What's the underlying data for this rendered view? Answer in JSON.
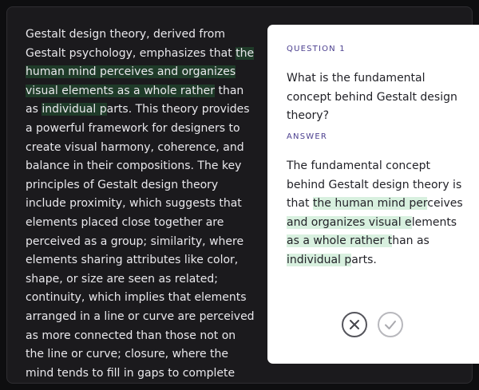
{
  "passage": {
    "segments": [
      {
        "text": "Gestalt design theory, derived from Gestalt psychology, emphasizes that ",
        "hl": false
      },
      {
        "text": "the human mind perceives and organizes visual elements as a whole rather",
        "hl": true
      },
      {
        "text": " than as ",
        "hl": false
      },
      {
        "text": "individual p",
        "hl": true
      },
      {
        "text": "arts. This theory provides a powerful framework for designers to create visual harmony, coherence, and balance in their compositions. The key principles of Gestalt design theory include proximity, which suggests that elements placed close together are perceived as a group; similarity, where elements sharing attributes like color, shape, or size are seen as related; continuity, which implies that elements arranged in a line or curve are perceived as more connected than those not on the line or curve; closure, where the mind tends to fill in gaps to complete shapes or patterns even when",
        "hl": false
      }
    ]
  },
  "card": {
    "question_label": "QUESTION 1",
    "question_text": "What is the fundamental concept behind Gestalt design theory?",
    "answer_label": "ANSWER",
    "answer_segments": [
      {
        "text": "The fundamental concept behind Gestalt design theory is that ",
        "hl": false
      },
      {
        "text": "the human mind per",
        "hl": true
      },
      {
        "text": "ceives ",
        "hl": false
      },
      {
        "text": "and organizes visual e",
        "hl": true
      },
      {
        "text": "lements ",
        "hl": false
      },
      {
        "text": "as a whole rather t",
        "hl": true
      },
      {
        "text": "han as ",
        "hl": false
      },
      {
        "text": "individual p",
        "hl": true
      },
      {
        "text": "arts.",
        "hl": false
      }
    ],
    "wrong_icon": "close-x-icon",
    "correct_icon": "checkmark-icon"
  },
  "colors": {
    "background": "#1b1a1d",
    "highlight_dark": "#1f3b29",
    "highlight_light": "#d8f0df",
    "label_accent": "#4b3f8f"
  }
}
